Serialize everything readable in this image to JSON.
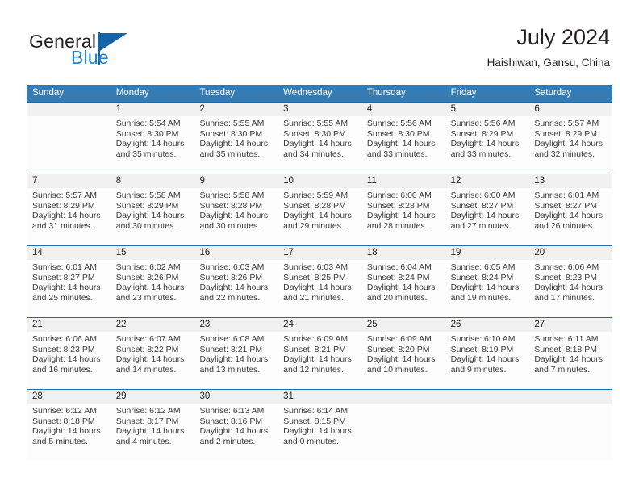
{
  "logo": {
    "word1": "General",
    "word2": "Blue",
    "mark": "triangle-mark",
    "accent": "#1564a8",
    "blue_text": "#2980c4"
  },
  "header": {
    "title": "July 2024",
    "location": "Haishiwan, Gansu, China"
  },
  "calendar": {
    "header_bg": "#357cb4",
    "row_divider": "#1f6cad",
    "number_band_bg": "#f0f0f0",
    "weekdays": [
      "Sunday",
      "Monday",
      "Tuesday",
      "Wednesday",
      "Thursday",
      "Friday",
      "Saturday"
    ],
    "weeks": [
      [
        {
          "day": "",
          "sunrise": "",
          "sunset": "",
          "daylight1": "",
          "daylight2": ""
        },
        {
          "day": "1",
          "sunrise": "Sunrise: 5:54 AM",
          "sunset": "Sunset: 8:30 PM",
          "daylight1": "Daylight: 14 hours",
          "daylight2": "and 35 minutes."
        },
        {
          "day": "2",
          "sunrise": "Sunrise: 5:55 AM",
          "sunset": "Sunset: 8:30 PM",
          "daylight1": "Daylight: 14 hours",
          "daylight2": "and 35 minutes."
        },
        {
          "day": "3",
          "sunrise": "Sunrise: 5:55 AM",
          "sunset": "Sunset: 8:30 PM",
          "daylight1": "Daylight: 14 hours",
          "daylight2": "and 34 minutes."
        },
        {
          "day": "4",
          "sunrise": "Sunrise: 5:56 AM",
          "sunset": "Sunset: 8:30 PM",
          "daylight1": "Daylight: 14 hours",
          "daylight2": "and 33 minutes."
        },
        {
          "day": "5",
          "sunrise": "Sunrise: 5:56 AM",
          "sunset": "Sunset: 8:29 PM",
          "daylight1": "Daylight: 14 hours",
          "daylight2": "and 33 minutes."
        },
        {
          "day": "6",
          "sunrise": "Sunrise: 5:57 AM",
          "sunset": "Sunset: 8:29 PM",
          "daylight1": "Daylight: 14 hours",
          "daylight2": "and 32 minutes."
        }
      ],
      [
        {
          "day": "7",
          "sunrise": "Sunrise: 5:57 AM",
          "sunset": "Sunset: 8:29 PM",
          "daylight1": "Daylight: 14 hours",
          "daylight2": "and 31 minutes."
        },
        {
          "day": "8",
          "sunrise": "Sunrise: 5:58 AM",
          "sunset": "Sunset: 8:29 PM",
          "daylight1": "Daylight: 14 hours",
          "daylight2": "and 30 minutes."
        },
        {
          "day": "9",
          "sunrise": "Sunrise: 5:58 AM",
          "sunset": "Sunset: 8:28 PM",
          "daylight1": "Daylight: 14 hours",
          "daylight2": "and 30 minutes."
        },
        {
          "day": "10",
          "sunrise": "Sunrise: 5:59 AM",
          "sunset": "Sunset: 8:28 PM",
          "daylight1": "Daylight: 14 hours",
          "daylight2": "and 29 minutes."
        },
        {
          "day": "11",
          "sunrise": "Sunrise: 6:00 AM",
          "sunset": "Sunset: 8:28 PM",
          "daylight1": "Daylight: 14 hours",
          "daylight2": "and 28 minutes."
        },
        {
          "day": "12",
          "sunrise": "Sunrise: 6:00 AM",
          "sunset": "Sunset: 8:27 PM",
          "daylight1": "Daylight: 14 hours",
          "daylight2": "and 27 minutes."
        },
        {
          "day": "13",
          "sunrise": "Sunrise: 6:01 AM",
          "sunset": "Sunset: 8:27 PM",
          "daylight1": "Daylight: 14 hours",
          "daylight2": "and 26 minutes."
        }
      ],
      [
        {
          "day": "14",
          "sunrise": "Sunrise: 6:01 AM",
          "sunset": "Sunset: 8:27 PM",
          "daylight1": "Daylight: 14 hours",
          "daylight2": "and 25 minutes."
        },
        {
          "day": "15",
          "sunrise": "Sunrise: 6:02 AM",
          "sunset": "Sunset: 8:26 PM",
          "daylight1": "Daylight: 14 hours",
          "daylight2": "and 23 minutes."
        },
        {
          "day": "16",
          "sunrise": "Sunrise: 6:03 AM",
          "sunset": "Sunset: 8:26 PM",
          "daylight1": "Daylight: 14 hours",
          "daylight2": "and 22 minutes."
        },
        {
          "day": "17",
          "sunrise": "Sunrise: 6:03 AM",
          "sunset": "Sunset: 8:25 PM",
          "daylight1": "Daylight: 14 hours",
          "daylight2": "and 21 minutes."
        },
        {
          "day": "18",
          "sunrise": "Sunrise: 6:04 AM",
          "sunset": "Sunset: 8:24 PM",
          "daylight1": "Daylight: 14 hours",
          "daylight2": "and 20 minutes."
        },
        {
          "day": "19",
          "sunrise": "Sunrise: 6:05 AM",
          "sunset": "Sunset: 8:24 PM",
          "daylight1": "Daylight: 14 hours",
          "daylight2": "and 19 minutes."
        },
        {
          "day": "20",
          "sunrise": "Sunrise: 6:06 AM",
          "sunset": "Sunset: 8:23 PM",
          "daylight1": "Daylight: 14 hours",
          "daylight2": "and 17 minutes."
        }
      ],
      [
        {
          "day": "21",
          "sunrise": "Sunrise: 6:06 AM",
          "sunset": "Sunset: 8:23 PM",
          "daylight1": "Daylight: 14 hours",
          "daylight2": "and 16 minutes."
        },
        {
          "day": "22",
          "sunrise": "Sunrise: 6:07 AM",
          "sunset": "Sunset: 8:22 PM",
          "daylight1": "Daylight: 14 hours",
          "daylight2": "and 14 minutes."
        },
        {
          "day": "23",
          "sunrise": "Sunrise: 6:08 AM",
          "sunset": "Sunset: 8:21 PM",
          "daylight1": "Daylight: 14 hours",
          "daylight2": "and 13 minutes."
        },
        {
          "day": "24",
          "sunrise": "Sunrise: 6:09 AM",
          "sunset": "Sunset: 8:21 PM",
          "daylight1": "Daylight: 14 hours",
          "daylight2": "and 12 minutes."
        },
        {
          "day": "25",
          "sunrise": "Sunrise: 6:09 AM",
          "sunset": "Sunset: 8:20 PM",
          "daylight1": "Daylight: 14 hours",
          "daylight2": "and 10 minutes."
        },
        {
          "day": "26",
          "sunrise": "Sunrise: 6:10 AM",
          "sunset": "Sunset: 8:19 PM",
          "daylight1": "Daylight: 14 hours",
          "daylight2": "and 9 minutes."
        },
        {
          "day": "27",
          "sunrise": "Sunrise: 6:11 AM",
          "sunset": "Sunset: 8:18 PM",
          "daylight1": "Daylight: 14 hours",
          "daylight2": "and 7 minutes."
        }
      ],
      [
        {
          "day": "28",
          "sunrise": "Sunrise: 6:12 AM",
          "sunset": "Sunset: 8:18 PM",
          "daylight1": "Daylight: 14 hours",
          "daylight2": "and 5 minutes."
        },
        {
          "day": "29",
          "sunrise": "Sunrise: 6:12 AM",
          "sunset": "Sunset: 8:17 PM",
          "daylight1": "Daylight: 14 hours",
          "daylight2": "and 4 minutes."
        },
        {
          "day": "30",
          "sunrise": "Sunrise: 6:13 AM",
          "sunset": "Sunset: 8:16 PM",
          "daylight1": "Daylight: 14 hours",
          "daylight2": "and 2 minutes."
        },
        {
          "day": "31",
          "sunrise": "Sunrise: 6:14 AM",
          "sunset": "Sunset: 8:15 PM",
          "daylight1": "Daylight: 14 hours",
          "daylight2": "and 0 minutes."
        },
        {
          "day": "",
          "sunrise": "",
          "sunset": "",
          "daylight1": "",
          "daylight2": ""
        },
        {
          "day": "",
          "sunrise": "",
          "sunset": "",
          "daylight1": "",
          "daylight2": ""
        },
        {
          "day": "",
          "sunrise": "",
          "sunset": "",
          "daylight1": "",
          "daylight2": ""
        }
      ]
    ]
  }
}
